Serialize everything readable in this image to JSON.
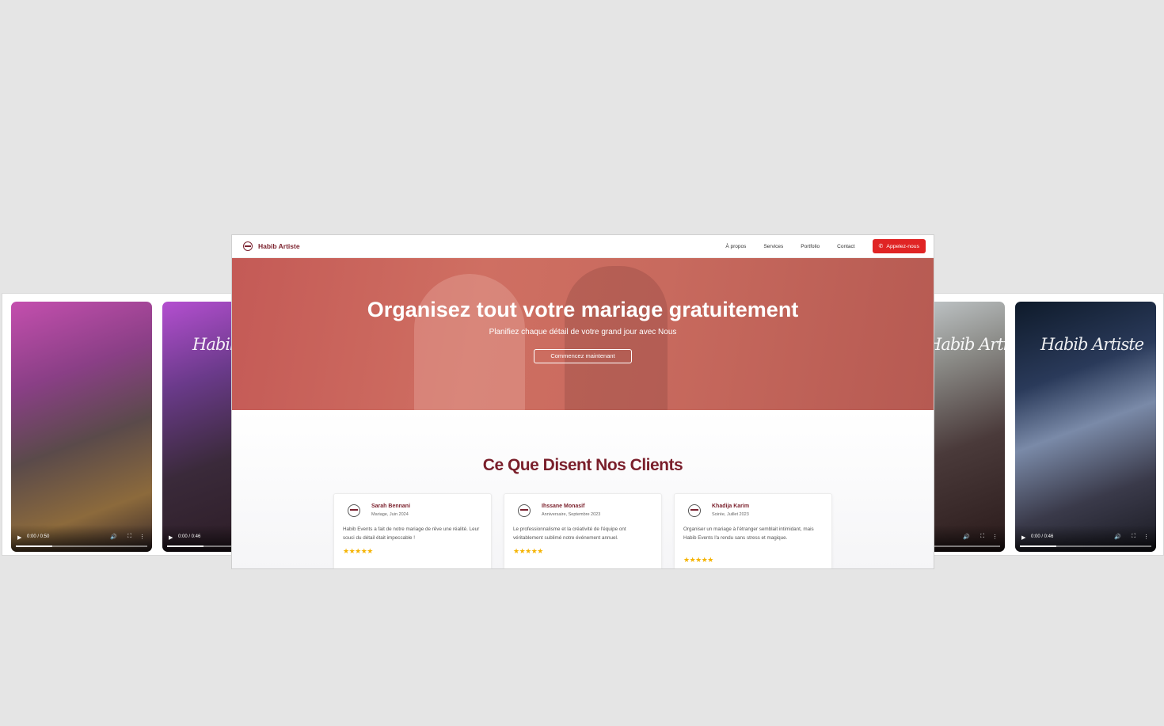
{
  "videos": [
    {
      "time": "0:00 / 0:50",
      "signature": ""
    },
    {
      "time": "0:00 / 0:46",
      "signature": "Habib Artiste"
    },
    {
      "time": "",
      "signature": "Habib Artiste"
    },
    {
      "time": "0:00 / 0:46",
      "signature": "Habib Artiste"
    }
  ],
  "nav": {
    "brand": "Habib Artiste",
    "links": [
      "À propos",
      "Services",
      "Portfolio",
      "Contact"
    ],
    "cta": "Appelez-nous"
  },
  "hero": {
    "title": "Organisez tout votre mariage gratuitement",
    "subtitle": "Planifiez chaque détail de votre grand jour avec Nous",
    "button": "Commencez maintenant"
  },
  "testimonials": {
    "heading": "Ce Que Disent Nos Clients",
    "items": [
      {
        "name": "Sarah Bennani",
        "event": "Mariage, Juin 2024",
        "text": "Habib Events a fait de notre mariage de rêve une réalité. Leur souci du détail était impeccable !",
        "stars": "★★★★★"
      },
      {
        "name": "Ihssane Monasif",
        "event": "Anniversaire, Septembre 2023",
        "text": "Le professionnalisme et la créativité de l'équipe ont véritablement sublimé notre événement annuel.",
        "stars": "★★★★★"
      },
      {
        "name": "Khadija Karim",
        "event": "Soirée, Juillet 2023",
        "text": "Organiser un mariage à l'étranger semblait intimidant, mais Habib Events l'a rendu sans stress et magique.",
        "stars": "★★★★★"
      }
    ]
  },
  "icons": {
    "play": "▶",
    "volume": "🔊",
    "fullscreen": "⛶",
    "more": "⋮",
    "phone": "✆"
  },
  "colors": {
    "accent": "#e02424",
    "brand": "#7a1f2b",
    "hero": "#c86a5e",
    "stars": "#f5b301"
  }
}
